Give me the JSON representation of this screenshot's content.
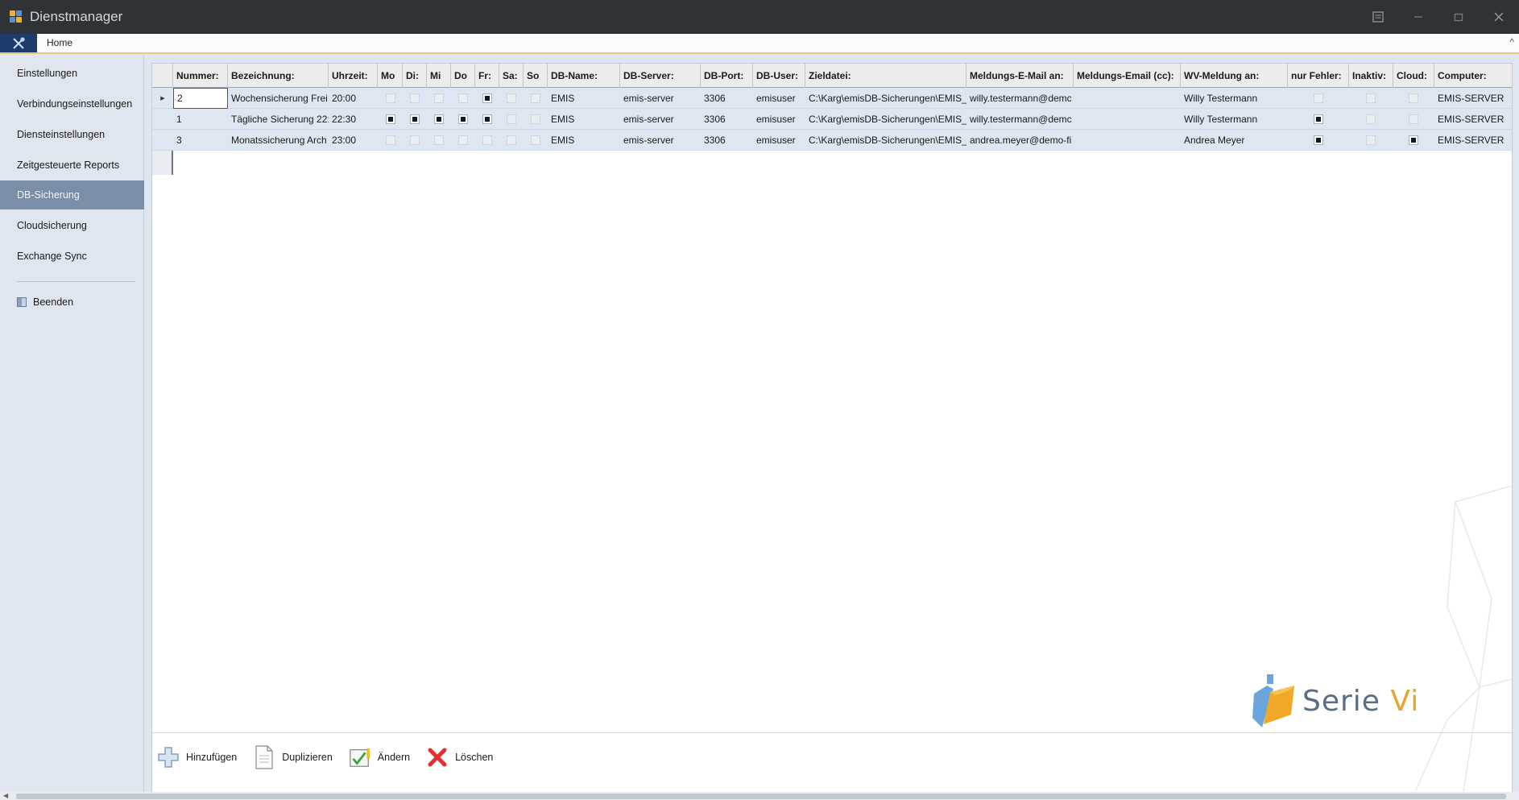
{
  "window": {
    "title": "Dienstmanager"
  },
  "ribbon": {
    "home_tab": "Home"
  },
  "sidebar": {
    "items": [
      {
        "label": "Einstellungen"
      },
      {
        "label": "Verbindungseinstellungen"
      },
      {
        "label": "Diensteinstellungen"
      },
      {
        "label": "Zeitgesteuerte Reports"
      },
      {
        "label": "DB-Sicherung",
        "active": true
      },
      {
        "label": "Cloudsicherung"
      },
      {
        "label": "Exchange Sync"
      }
    ],
    "exit_label": "Beenden"
  },
  "grid": {
    "columns": [
      "Nummer:",
      "Bezeichnung:",
      "Uhrzeit:",
      "Mo",
      "Di:",
      "Mi",
      "Do",
      "Fr:",
      "Sa:",
      "So",
      "DB-Name:",
      "DB-Server:",
      "DB-Port:",
      "DB-User:",
      "Zieldatei:",
      "Meldungs-E-Mail an:",
      "Meldungs-Email (cc):",
      "WV-Meldung an:",
      "nur Fehler:",
      "Inaktiv:",
      "Cloud:",
      "Computer:"
    ],
    "rows": [
      {
        "nummer": "2",
        "bezeichnung": "Wochensicherung Frei",
        "uhrzeit": "20:00",
        "days": [
          false,
          false,
          false,
          false,
          true,
          false,
          false
        ],
        "db_name": "EMIS",
        "db_server": "emis-server",
        "db_port": "3306",
        "db_user": "emisuser",
        "zieldatei": "C:\\Karg\\emisDB-Sicherungen\\EMIS_\\",
        "email": "willy.testermann@demc",
        "email_cc": "",
        "wv": "Willy Testermann",
        "nur_fehler": false,
        "inaktiv": false,
        "cloud": false,
        "computer": "EMIS-SERVER",
        "current": true
      },
      {
        "nummer": "1",
        "bezeichnung": "Tägliche Sicherung 22:",
        "uhrzeit": "22:30",
        "days": [
          true,
          true,
          true,
          true,
          true,
          false,
          false
        ],
        "db_name": "EMIS",
        "db_server": "emis-server",
        "db_port": "3306",
        "db_user": "emisuser",
        "zieldatei": "C:\\Karg\\emisDB-Sicherungen\\EMIS_t",
        "email": "willy.testermann@demc",
        "email_cc": "",
        "wv": "Willy Testermann",
        "nur_fehler": true,
        "inaktiv": false,
        "cloud": false,
        "computer": "EMIS-SERVER",
        "current": false
      },
      {
        "nummer": "3",
        "bezeichnung": "Monatssicherung Arch",
        "uhrzeit": "23:00",
        "days": [
          false,
          false,
          false,
          false,
          false,
          false,
          false
        ],
        "db_name": "EMIS",
        "db_server": "emis-server",
        "db_port": "3306",
        "db_user": "emisuser",
        "zieldatei": "C:\\Karg\\emisDB-Sicherungen\\EMIS_r",
        "email": "andrea.meyer@demo-fi",
        "email_cc": "",
        "wv": "Andrea Meyer",
        "nur_fehler": true,
        "inaktiv": false,
        "cloud": true,
        "computer": "EMIS-SERVER",
        "current": false
      }
    ]
  },
  "toolbar": {
    "add_label": "Hinzufügen",
    "duplicate_label": "Duplizieren",
    "edit_label": "Ändern",
    "delete_label": "Löschen"
  },
  "logo": {
    "text_main": "Serie ",
    "text_accent": "Vi"
  },
  "colors": {
    "title_bar": "#2f3336",
    "active_nav": "#7a8ea8",
    "row_bg": "#dde6f1",
    "logo_accent": "#e8a42e",
    "delete_red": "#e03030"
  }
}
